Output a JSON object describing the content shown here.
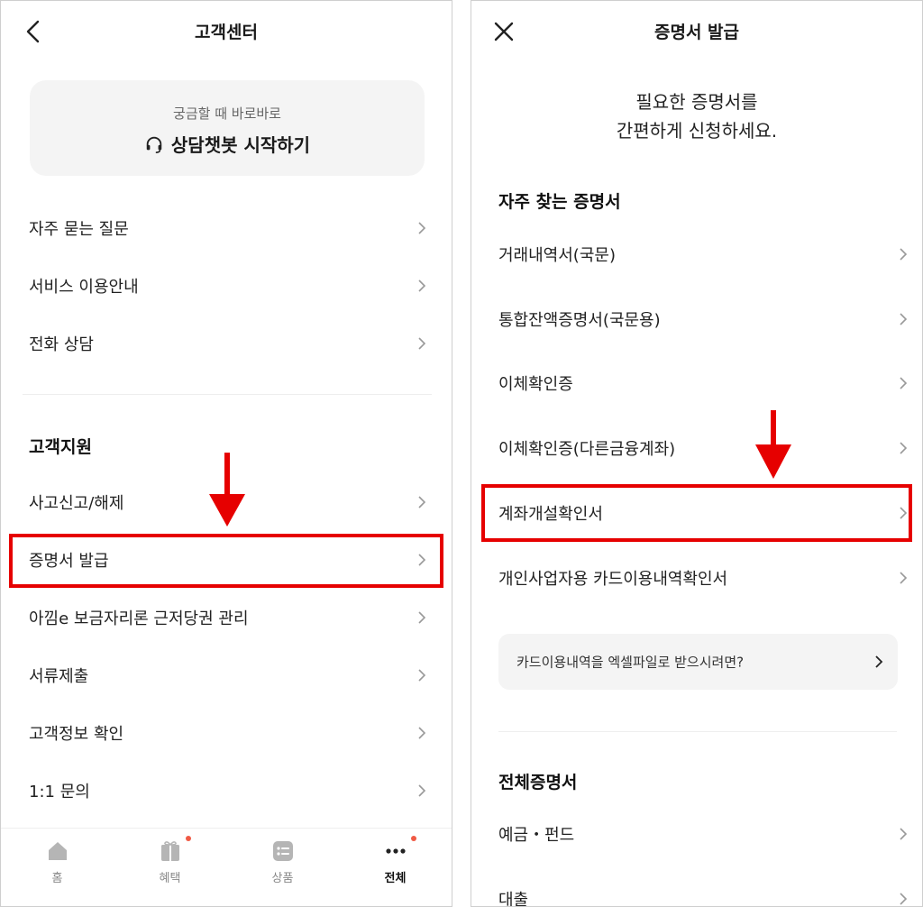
{
  "left": {
    "header_title": "고객센터",
    "back_icon": "chevron-left-icon",
    "chatbot": {
      "subtitle": "궁금할 때 바로바로",
      "title": "상담챗봇 시작하기",
      "icon": "headset-icon"
    },
    "top_menu": [
      {
        "label": "자주 묻는 질문"
      },
      {
        "label": "서비스 이용안내"
      },
      {
        "label": "전화 상담"
      }
    ],
    "support_section": {
      "title": "고객지원",
      "items": [
        {
          "label": "사고신고/해제"
        },
        {
          "label": "증명서 발급"
        },
        {
          "label": "아낌e 보금자리론 근저당권 관리"
        },
        {
          "label": "서류제출"
        },
        {
          "label": "고객정보 확인"
        },
        {
          "label": "1:1 문의"
        }
      ]
    },
    "bottom_nav": [
      {
        "label": "홈",
        "icon": "home-icon",
        "badge": false
      },
      {
        "label": "혜택",
        "icon": "gift-icon",
        "badge": true
      },
      {
        "label": "상품",
        "icon": "product-list-icon",
        "badge": false
      },
      {
        "label": "전체",
        "icon": "more-dots-icon",
        "badge": true,
        "active": true
      }
    ]
  },
  "right": {
    "header_title": "증명서 발급",
    "close_icon": "close-icon",
    "intro_line1": "필요한 증명서를",
    "intro_line2": "간편하게 신청하세요.",
    "frequent_section": {
      "title": "자주 찾는 증명서",
      "items": [
        {
          "label": "거래내역서(국문)"
        },
        {
          "label": "통합잔액증명서(국문용)"
        },
        {
          "label": "이체확인증"
        },
        {
          "label": "이체확인증(다른금융계좌)"
        },
        {
          "label": "계좌개설확인서"
        },
        {
          "label": "개인사업자용 카드이용내역확인서"
        }
      ]
    },
    "excel_card": {
      "label": "카드이용내역을 엑셀파일로 받으시려면?"
    },
    "all_section": {
      "title": "전체증명서",
      "items": [
        {
          "label": "예금・펀드"
        },
        {
          "label": "대출"
        }
      ]
    }
  },
  "colors": {
    "highlight": "#e60000",
    "badge": "#f05a45",
    "card_bg": "#f4f4f4"
  }
}
